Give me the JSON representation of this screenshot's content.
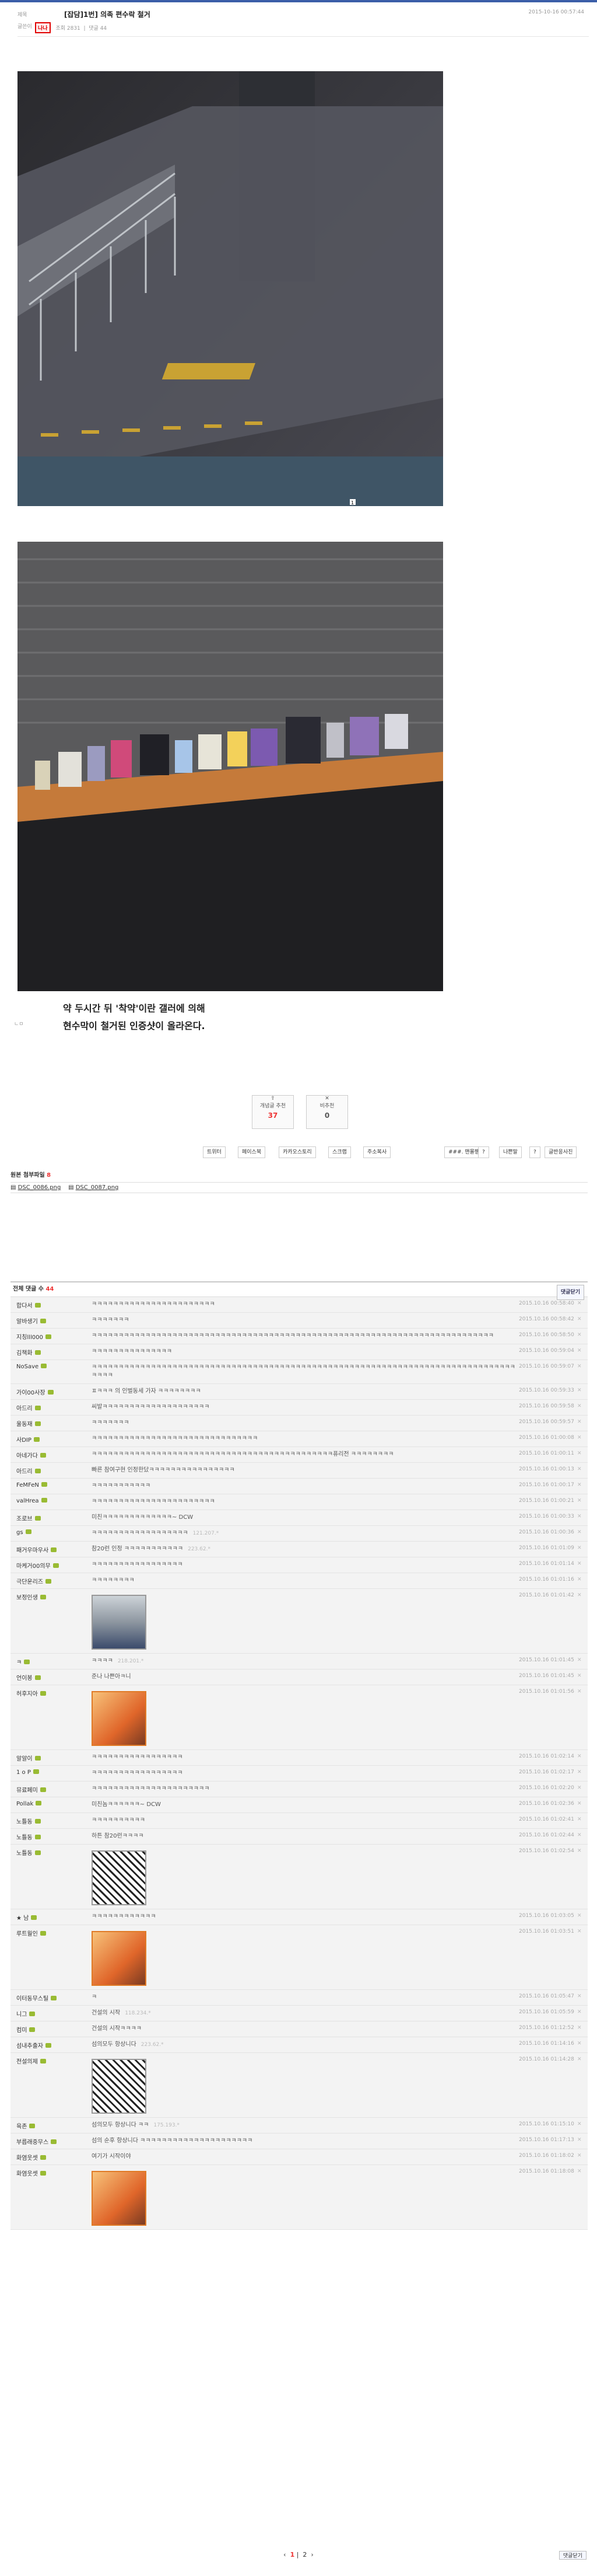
{
  "header": {
    "bar_labels": [
      "제목",
      "글쓴이"
    ],
    "title": "[잡담]1번] 의족 편수락 철거",
    "date": "2015-10-16 00:57:44",
    "author": "나나",
    "views_label": "조회",
    "views": "2831",
    "comments_label": "댓글",
    "comments_count": "44"
  },
  "post": {
    "caption_line1": "약 두시간 뒤 '착약'이란 갤러에 의해",
    "caption_line2": "현수막이 철거된 인증샷이 올라온다.",
    "caption_tag": "ㄴㅁ",
    "photo_badge": "1"
  },
  "votes": {
    "up_label": "개념글 추천",
    "up_value": "37",
    "down_label": "비추천",
    "down_value": "0"
  },
  "share_buttons": [
    "트위터",
    "페이스북",
    "카카오스토리",
    "스크랩",
    "주소복사"
  ],
  "right_buttons": [
    "###. 맨몰쨈",
    "?",
    "나쁜말",
    "?",
    "글반응사진"
  ],
  "sources": {
    "title": "원본 첨부파일",
    "count": "8",
    "files": [
      "DSC_0086.png",
      "DSC_0087.png"
    ]
  },
  "comments_section": {
    "title": "전체 댓글 수",
    "count": "44",
    "reload_label": "댓글닫기"
  },
  "comments": [
    {
      "nick": "합다서",
      "text": "ㅋㅋㅋㅋㅋㅋㅋㅋㅋㅋㅋㅋㅋㅋㅋㅋㅋㅋㅋㅋㅋㅋㅋ",
      "time": "2015.10.16 00:58:40"
    },
    {
      "nick": "알바생기",
      "text": "ㅋㅋㅋㅋㅋㅋㅋ",
      "time": "2015.10.16 00:58:42"
    },
    {
      "nick": "지칭lll000",
      "text": "ㅋㅋㅋㅋㅋㅋㅋㅋㅋㅋㅋㅋㅋㅋㅋㅋㅋㅋㅋㅋㅋㅋㅋㅋㅋㅋㅋㅋㅋㅋㅋㅋㅋㅋㅋㅋㅋㅋㅋㅋㅋㅋㅋㅋㅋㅋㅋㅋㅋㅋㅋㅋㅋㅋㅋㅋㅋㅋㅋㅋㅋㅋㅋㅋㅋㅋㅋㅋㅋㅋㅋㅋㅋㅋㅋ",
      "time": "2015.10.16 00:58:50"
    },
    {
      "nick": "김책화",
      "text": "ㅋㅋㅋㅋㅋㅋㅋㅋㅋㅋㅋㅋㅋㅋㅋ",
      "time": "2015.10.16 00:59:04"
    },
    {
      "nick": "NoSave",
      "text": "ㅋㅋㅋㅋㅋㅋㅋㅋㅋㅋㅋㅋㅋㅋㅋㅋㅋㅋㅋㅋㅋㅋㅋㅋㅋㅋㅋㅋㅋㅋㅋㅋㅋㅋㅋㅋㅋㅋㅋㅋㅋㅋㅋㅋㅋㅋㅋㅋㅋㅋㅋㅋㅋㅋㅋㅋㅋㅋㅋㅋㅋㅋㅋㅋㅋㅋㅋㅋㅋㅋㅋㅋㅋㅋㅋㅋㅋㅋㅋㅋㅋㅋㅋ",
      "time": "2015.10.16 00:59:07"
    },
    {
      "nick": "가이00사장",
      "text": "ㅍㅋㅋㅋ 의 인벌동세 가자 ㅋㅋㅋㅋㅋㅋㅋㅋ",
      "time": "2015.10.16 00:59:33"
    },
    {
      "nick": "아드리",
      "text": "씨발ㅋㅋㅋㅋㅋㅋㅋㅋㅋㅋㅋㅋㅋㅋㅋㅋㅋㅋㅋㅋ",
      "time": "2015.10.16 00:59:58"
    },
    {
      "nick": "울동재",
      "text": "ㅋㅋㅋㅋㅋㅋㅋ",
      "time": "2015.10.16 00:59:57"
    },
    {
      "nick": "사DIP",
      "text": "ㅋㅋㅋㅋㅋㅋㅋㅋㅋㅋㅋㅋㅋㅋㅋㅋㅋㅋㅋㅋㅋㅋㅋㅋㅋㅋㅋㅋㅋㅋㅋ",
      "time": "2015.10.16 01:00:08"
    },
    {
      "nick": "아네가다",
      "text": "ㅋㅋㅋㅋㅋㅋㅋㅋㅋㅋㅋㅋㅋㅋㅋㅋㅋㅋㅋㅋㅋㅋㅋㅋㅋㅋㅋㅋㅋㅋㅋㅋㅋㅋㅋㅋㅋㅋㅋㅋㅋㅋㅋㅋㅋ퓨리전 ㅋㅋㅋㅋㅋㅋㅋㅋ",
      "time": "2015.10.16 01:00:11"
    },
    {
      "nick": "아드리",
      "text": "빠른 참여구현 인정한닸ㅋㅋㅋㅋㅋㅋㅋㅋㅋㅋㅋㅋㅋㅋㅋㅋ",
      "time": "2015.10.16 01:00:13"
    },
    {
      "nick": "FeMFeN",
      "text": "ㅋㅋㅋㅋㅋㅋㅋㅋㅋㅋㅋ",
      "time": "2015.10.16 01:00:17"
    },
    {
      "nick": "valHrea",
      "text": "ㅋㅋㅋㅋㅋㅋㅋㅋㅋㅋㅋㅋㅋㅋㅋㅋㅋㅋㅋㅋㅋㅋㅋ",
      "time": "2015.10.16 01:00:21"
    },
    {
      "nick": "조로브",
      "text": "미친ㅋㅋㅋㅋㅋㅋㅋㅋㅋㅋㅋㅋㅋ~ DCW",
      "time": "2015.10.16 01:00:33"
    },
    {
      "nick": "gs",
      "text": "ㅋㅋㅋㅋㅋㅋㅋㅋㅋㅋㅋㅋㅋㅋㅋㅋㅋㅋ",
      "sub": "121.207.*",
      "time": "2015.10.16 01:00:36"
    },
    {
      "nick": "패거우마우사",
      "text": "참20런 인정 ㅋㅋㅋㅋㅋㅋㅋㅋㅋㅋㅋ",
      "sub": "223.62.*",
      "time": "2015.10.16 01:01:09"
    },
    {
      "nick": "마케거00의무",
      "text": "ㅋㅋㅋㅋㅋㅋㅋㅋㅋㅋㅋㅋㅋㅋㅋㅋㅋ",
      "time": "2015.10.16 01:01:14"
    },
    {
      "nick": "극단운리즈",
      "text": "ㅋㅋㅋㅋㅋㅋㅋㅋ",
      "time": "2015.10.16 01:01:16"
    },
    {
      "nick": "보정인생",
      "text": "",
      "thumb": "photo",
      "time": "2015.10.16 01:01:42"
    },
    {
      "nick": "ㅋ",
      "text": "ㅋㅋㅋㅋ",
      "sub": "218.201.*",
      "time": "2015.10.16 01:01:45"
    },
    {
      "nick": "언이봉",
      "text": "준나 나쁜아ㅋ니",
      "time": "2015.10.16 01:01:45"
    },
    {
      "nick": "허후지아",
      "text": "",
      "thumb": "anime",
      "time": "2015.10.16 01:01:56"
    },
    {
      "nick": "알알이",
      "text": "ㅋㅋㅋㅋㅋㅋㅋㅋㅋㅋㅋㅋㅋㅋㅋㅋㅋ",
      "time": "2015.10.16 01:02:14"
    },
    {
      "nick": "1 o P",
      "text": "ㅋㅋㅋㅋㅋㅋㅋㅋㅋㅋㅋㅋㅋㅋㅋㅋㅋ",
      "time": "2015.10.16 01:02:17"
    },
    {
      "nick": "뮤료페미",
      "text": "ㅋㅋㅋㅋㅋㅋㅋㅋㅋㅋㅋㅋㅋㅋㅋㅋㅋㅋㅋㅋㅋㅋ",
      "time": "2015.10.16 01:02:20"
    },
    {
      "nick": "Pollak",
      "text": "미친놈ㅋㅋㅋㅋㅋㅋ~ DCW",
      "time": "2015.10.16 01:02:36"
    },
    {
      "nick": "노틀동",
      "text": "ㅋㅋㅋㅋㅋㅋㅋㅋㅋㅋ",
      "time": "2015.10.16 01:02:41"
    },
    {
      "nick": "노틀동",
      "text": "하튼 참20런ㅋㅋㅋㅋ",
      "time": "2015.10.16 01:02:44"
    },
    {
      "nick": "노틀동",
      "text": "",
      "thumb": "manga",
      "time": "2015.10.16 01:02:54"
    },
    {
      "nick": "★ 남",
      "text": "ㅋㅋㅋㅋㅋㅋㅋㅋㅋㅋㅋㅋ",
      "time": "2015.10.16 01:03:05"
    },
    {
      "nick": "루트월인",
      "text": "",
      "thumb": "anime",
      "time": "2015.10.16 01:03:51"
    },
    {
      "nick": "이터동무스틸",
      "text": "ㅋ",
      "time": "2015.10.16 01:05:47"
    },
    {
      "nick": "니그",
      "text": "건설의 시작",
      "sub": "118.234.*",
      "time": "2015.10.16 01:05:59"
    },
    {
      "nick": "컴미",
      "text": "건설의 시작ㅋㅋㅋㅋ",
      "time": "2015.10.16 01:12:52"
    },
    {
      "nick": "섬내추출자",
      "text": "섬의모두 항상니다",
      "sub": "223.62.*",
      "time": "2015.10.16 01:14:16"
    },
    {
      "nick": "전설의제",
      "text": "",
      "thumb": "manga",
      "time": "2015.10.16 01:14:28"
    },
    {
      "nick": "육존",
      "text": "섬의모두 항상니다 ㅋㅋ",
      "sub": "175.193.*",
      "time": "2015.10.16 01:15:10"
    },
    {
      "nick": "부릅래중무스",
      "text": "섬의 순후 항상니다 ㅋㅋㅋㅋㅋㅋㅋㅋㅋㅋㅋㅋㅋㅋㅋㅋㅋㅋㅋㅋㅋ",
      "time": "2015.10.16 01:17:13"
    },
    {
      "nick": "화염웃셋",
      "text": "여기가 시작이야",
      "time": "2015.10.16 01:18:02"
    },
    {
      "nick": "화염웃셋",
      "text": "",
      "thumb": "anime",
      "time": "2015.10.16 01:18:08"
    }
  ],
  "pager": {
    "prev": "‹",
    "pages": [
      "1",
      "2"
    ],
    "current": "1",
    "next": "›",
    "bottom_button": "댓글닫기"
  }
}
